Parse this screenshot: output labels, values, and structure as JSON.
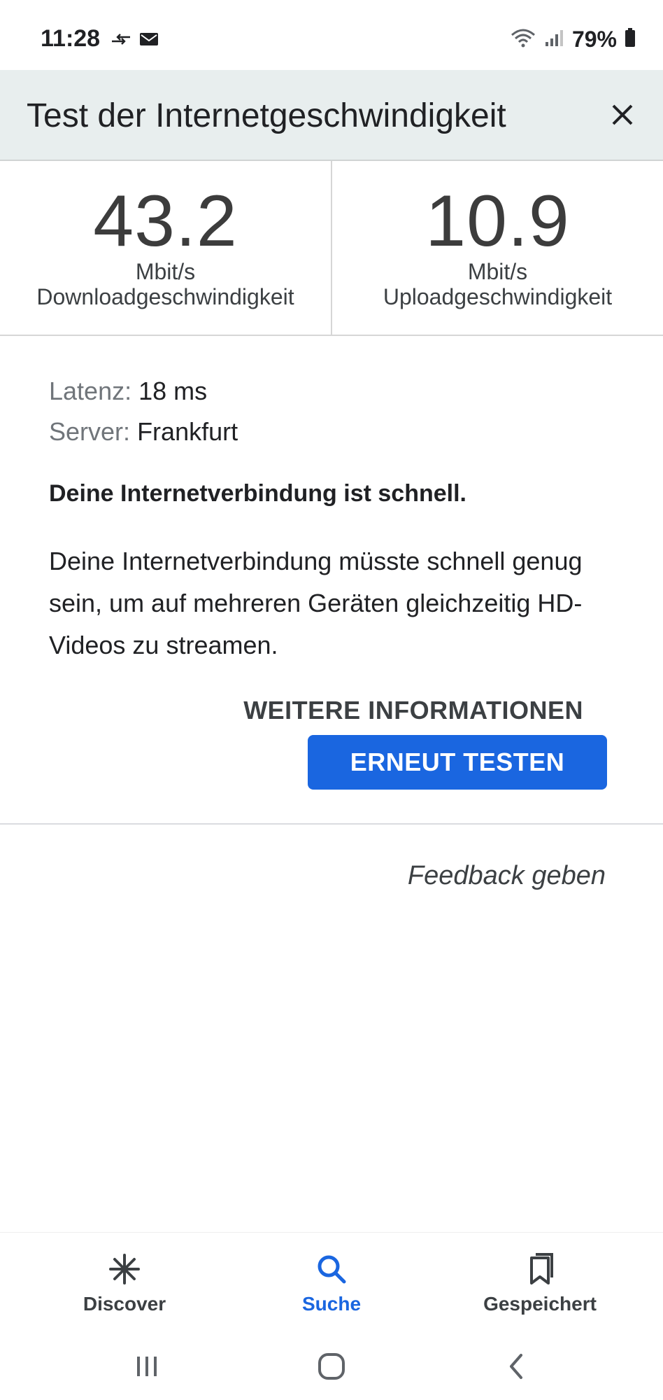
{
  "status_bar": {
    "time": "11:28",
    "battery": "79%"
  },
  "header": {
    "title": "Test der Internetgeschwindigkeit"
  },
  "metrics": {
    "download": {
      "value": "43.2",
      "unit": "Mbit/s",
      "label": "Downloadgeschwindigkeit"
    },
    "upload": {
      "value": "10.9",
      "unit": "Mbit/s",
      "label": "Uploadgeschwindigkeit"
    }
  },
  "info": {
    "latency_label": "Latenz:",
    "latency_value": "18 ms",
    "server_label": "Server:",
    "server_value": "Frankfurt"
  },
  "verdict": "Deine Internetverbindung ist schnell.",
  "description": "Deine Internetverbindung müsste schnell genug sein, um auf mehreren Geräten gleichzeitig HD-Videos zu streamen.",
  "actions": {
    "more_info": "WEITERE INFORMATIONEN",
    "retest": "ERNEUT TESTEN",
    "feedback": "Feedback geben"
  },
  "bottom_nav": {
    "items": [
      {
        "label": "Discover",
        "icon": "asterisk-icon"
      },
      {
        "label": "Suche",
        "icon": "search-icon"
      },
      {
        "label": "Gespeichert",
        "icon": "bookmarks-icon"
      }
    ]
  },
  "colors": {
    "accent": "#1a66e0",
    "header_bg": "#e8eeee"
  }
}
